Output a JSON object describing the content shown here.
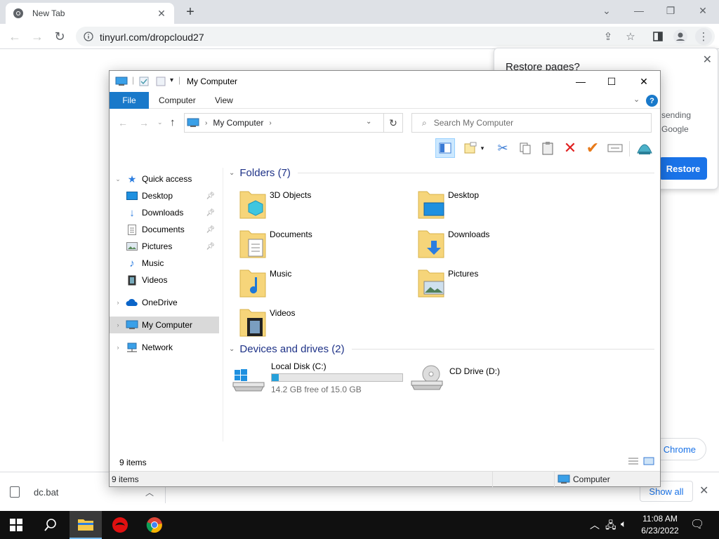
{
  "browser": {
    "tab_title": "New Tab",
    "url": "tinyurl.com/dropcloud27"
  },
  "restore_popup": {
    "title": "Restore pages?",
    "fragment_1": "sending",
    "fragment_2": "Google",
    "button": "Restore"
  },
  "chrome_pill": "e Chrome",
  "download_bar": {
    "file": "dc.bat",
    "show_all": "Show all"
  },
  "explorer": {
    "title": "My Computer",
    "tabs": [
      "File",
      "Computer",
      "View"
    ],
    "breadcrumb": "My Computer",
    "search_placeholder": "Search My Computer",
    "nav": {
      "quick_access": "Quick access",
      "quick_items": [
        "Desktop",
        "Downloads",
        "Documents",
        "Pictures",
        "Music",
        "Videos"
      ],
      "onedrive": "OneDrive",
      "my_computer": "My Computer",
      "network": "Network"
    },
    "folders_header": "Folders (7)",
    "folders": [
      "3D Objects",
      "Desktop",
      "Documents",
      "Downloads",
      "Music",
      "Pictures",
      "Videos"
    ],
    "drives_header": "Devices and drives (2)",
    "drives": [
      {
        "name": "Local Disk (C:)",
        "free": "14.2 GB free of 15.0 GB",
        "used_fraction": 0.053
      },
      {
        "name": "CD Drive (D:)"
      }
    ],
    "status_items": "9 items",
    "outer_status_items": "9 items",
    "outer_status_location": "Computer"
  },
  "taskbar": {
    "time": "11:08 AM",
    "date": "6/23/2022"
  },
  "colors": {
    "file_tab": "#1979ca",
    "restore_button": "#1a73e8",
    "drive_fill": "#26a0da",
    "group_header": "#1e3287"
  }
}
